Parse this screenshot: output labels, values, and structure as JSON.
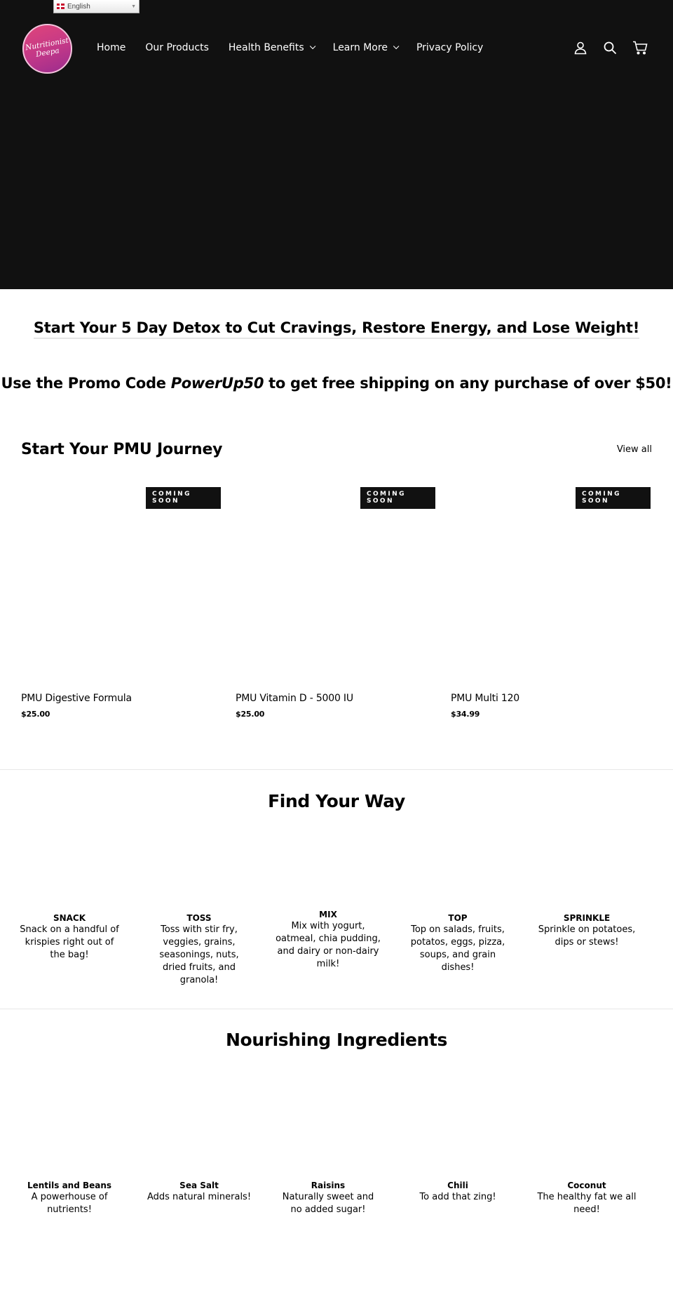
{
  "language_selector": {
    "value": "English",
    "flag": "uk-flag-icon"
  },
  "brand": {
    "logo_line1": "Nutritionist",
    "logo_line2": "Deepa",
    "colors": {
      "header_bg": "#111111",
      "logo_pink": "#d83f80",
      "logo_purple": "#9a2c8e"
    }
  },
  "nav": {
    "items": [
      {
        "label": "Home",
        "has_dropdown": false
      },
      {
        "label": "Our Products",
        "has_dropdown": false
      },
      {
        "label": "Health Benefits",
        "has_dropdown": true
      },
      {
        "label": "Learn More",
        "has_dropdown": true
      },
      {
        "label": "Privacy Policy",
        "has_dropdown": false
      }
    ],
    "icons": [
      "account-icon",
      "search-icon",
      "cart-icon"
    ]
  },
  "headline": "Start Your 5 Day Detox to Cut Cravings, Restore Energy, and Lose Weight!",
  "promo": {
    "before": "Use the Promo Code ",
    "code": "PowerUp50",
    "after": " to get free shipping on any purchase of over $50!"
  },
  "featured": {
    "title": "Start Your PMU Journey",
    "view_all": "View all",
    "products": [
      {
        "badge": "COMING SOON",
        "name": "PMU Digestive Formula",
        "price": "$25.00"
      },
      {
        "badge": "COMING SOON",
        "name": "PMU Vitamin D - 5000 IU",
        "price": "$25.00"
      },
      {
        "badge": "COMING SOON",
        "name": "PMU Multi 120",
        "price": "$34.99"
      }
    ]
  },
  "find_your_way": {
    "title": "Find Your Way",
    "items": [
      {
        "title": "SNACK",
        "desc": "Snack on a handful of krispies right out of the bag!"
      },
      {
        "title": "TOSS",
        "desc": "Toss with stir fry, veggies, grains, seasonings, nuts, dried fruits, and granola!"
      },
      {
        "title": "MIX",
        "desc": "Mix with yogurt, oatmeal, chia pudding, and dairy or non-dairy milk!"
      },
      {
        "title": "TOP",
        "desc": "Top on salads, fruits, potatos, eggs, pizza, soups, and grain dishes!"
      },
      {
        "title": "SPRINKLE",
        "desc": "Sprinkle on potatoes, dips or stews!"
      }
    ]
  },
  "ingredients": {
    "title": "Nourishing Ingredients",
    "items": [
      {
        "title": "Lentils and Beans",
        "desc": "A powerhouse of nutrients!"
      },
      {
        "title": "Sea Salt",
        "desc": "Adds natural minerals!"
      },
      {
        "title": "Raisins",
        "desc": "Naturally sweet and no added sugar!"
      },
      {
        "title": "Chili",
        "desc": "To add that zing!"
      },
      {
        "title": "Coconut",
        "desc": "The healthy fat we all need!"
      }
    ]
  }
}
